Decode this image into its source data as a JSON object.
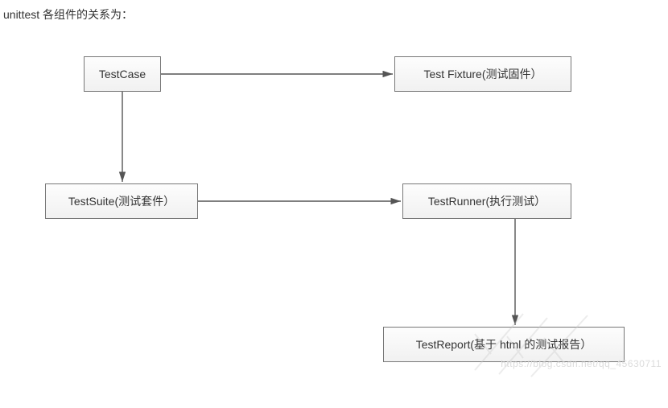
{
  "title": "unittest 各组件的关系为：",
  "nodes": {
    "testcase": {
      "label": "TestCase"
    },
    "fixture": {
      "label": "Test Fixture(测试固件）"
    },
    "testsuite": {
      "label": "TestSuite(测试套件）"
    },
    "testrunner": {
      "label": "TestRunner(执行测试）"
    },
    "testreport": {
      "label": "TestReport(基于 html 的测试报告）"
    }
  },
  "edges": [
    {
      "from": "testcase",
      "to": "fixture"
    },
    {
      "from": "testcase",
      "to": "testsuite"
    },
    {
      "from": "testsuite",
      "to": "testrunner"
    },
    {
      "from": "testrunner",
      "to": "testreport"
    }
  ],
  "watermark": "https://blog.csdn.net/qq_45630711",
  "chart_data": {
    "type": "diagram",
    "title": "unittest 各组件的关系为：",
    "nodes": [
      {
        "id": "TestCase",
        "label": "TestCase"
      },
      {
        "id": "TestFixture",
        "label": "Test Fixture(测试固件）"
      },
      {
        "id": "TestSuite",
        "label": "TestSuite(测试套件）"
      },
      {
        "id": "TestRunner",
        "label": "TestRunner(执行测试）"
      },
      {
        "id": "TestReport",
        "label": "TestReport(基于 html 的测试报告）"
      }
    ],
    "edges": [
      {
        "from": "TestCase",
        "to": "TestFixture"
      },
      {
        "from": "TestCase",
        "to": "TestSuite"
      },
      {
        "from": "TestSuite",
        "to": "TestRunner"
      },
      {
        "from": "TestRunner",
        "to": "TestReport"
      }
    ]
  }
}
